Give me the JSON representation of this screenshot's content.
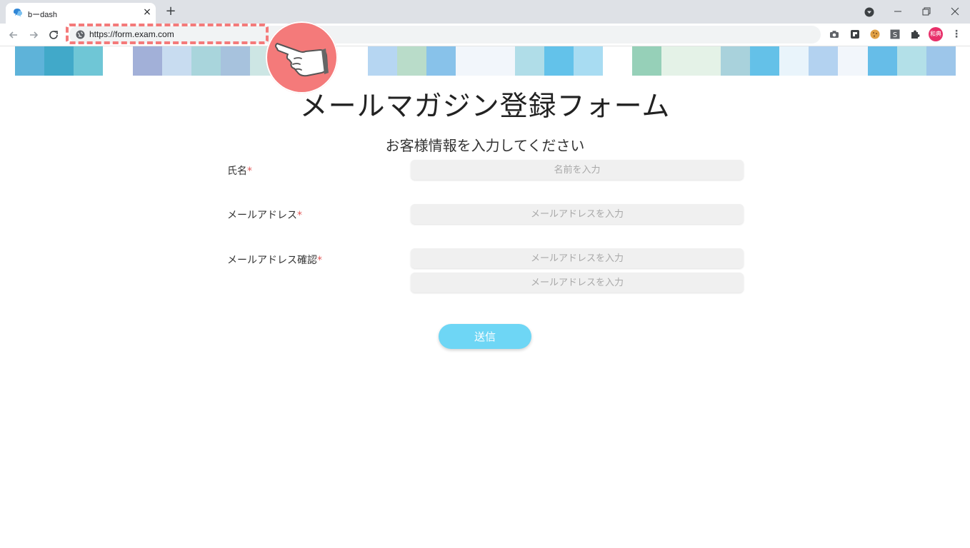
{
  "browser": {
    "tab_title": "bーdash",
    "tab_close": "×",
    "new_tab": "+",
    "url": "https://form.exam.com",
    "profile_initials": "和典",
    "menu": "⋮"
  },
  "banner": {
    "colors": [
      "#5eb3d9",
      "#41a9c9",
      "#6fc6d6",
      "#ffffff",
      "#a2b0d8",
      "#c8dcf0",
      "#a9d5dc",
      "#a7c2dd",
      "#cde6e4",
      "#a4dcf2",
      "#ffffff",
      "#ffffff",
      "#b6d6f2",
      "#b9dcc9",
      "#88c2ea",
      "#f2f6fb",
      "#f2f6fb",
      "#b0dde8",
      "#63c2ea",
      "#a8dcf2",
      "#ffffff",
      "#96d0b8",
      "#e4f2e7",
      "#e4f2e7",
      "#a9d2dc",
      "#64c1e8",
      "#e9f4fb",
      "#b3d2f0",
      "#f2f6fb",
      "#66bde8",
      "#b3e0e8",
      "#9dc6ea"
    ]
  },
  "form": {
    "title": "メールマガジン登録フォーム",
    "subtitle": "お客様情報を入力してください",
    "required_mark": "*",
    "name_label": "氏名",
    "name_placeholder": "名前を入力",
    "email_label": "メールアドレス",
    "email_placeholder": "メールアドレスを入力",
    "email_confirm_label": "メールアドレス確認",
    "email_confirm_placeholder": "メールアドレスを入力",
    "email_confirm_placeholder_2": "メールアドレスを入力",
    "submit_label": "送信"
  },
  "colors": {
    "accent": "#6ed6f5",
    "annotation": "#f47a7a",
    "required": "#e25858"
  },
  "icons": [
    "chat-bubble-icon",
    "back-arrow-icon",
    "forward-arrow-icon",
    "reload-icon",
    "globe-icon",
    "camera-icon",
    "extension-icon",
    "cookie-icon",
    "s-extension-icon",
    "puzzle-icon",
    "pointing-hand-icon"
  ]
}
